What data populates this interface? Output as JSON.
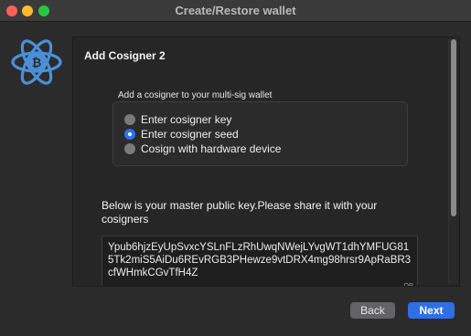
{
  "window": {
    "title": "Create/Restore wallet"
  },
  "wizard": {
    "title": "Add Cosigner 2",
    "group_label": "Add a cosigner to your multi-sig wallet",
    "options": [
      {
        "label": "Enter cosigner key",
        "selected": false
      },
      {
        "label": "Enter cosigner seed",
        "selected": true
      },
      {
        "label": "Cosign with hardware device",
        "selected": false
      }
    ],
    "share_text": "Below is your master public key.Please share it with your cosigners",
    "master_public_key": "Ypub6hjzEyUpSvxcYSLnFLzRhUwqNWejLYvgWT1dhYMFUG815Tk2miS5AiDu6REvRGB3PHewze9vtDRX4mg98hrsr9ApRaBR3cfWHmkCGvTfH4Z",
    "qr_tag": "QR"
  },
  "buttons": {
    "back": "Back",
    "next": "Next"
  },
  "colors": {
    "accent": "#2e6fe8",
    "logo": "#4a90d9"
  },
  "icons": {
    "logo": "electrum-bitcoin-logo-icon"
  }
}
